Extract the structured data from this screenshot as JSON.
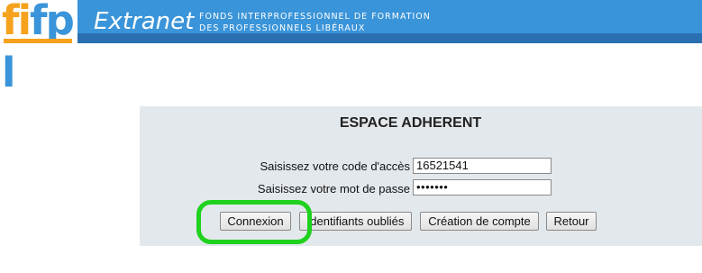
{
  "header": {
    "logo_letters": [
      "f",
      "i",
      "f",
      "p",
      "l"
    ],
    "logo_colors": [
      "#f6a21d",
      "#f6a21d",
      "#3a94d9",
      "#3a94d9",
      "#3a94d9"
    ],
    "title": "Extranet",
    "subtitle_line1": "FONDS INTERPROFESSIONNEL DE FORMATION",
    "subtitle_line2": "DES PROFESSIONNELS LIBÉRAUX"
  },
  "login": {
    "title": "ESPACE ADHERENT",
    "code_label": "Saisissez votre code d'accès",
    "code_value": "16521541",
    "password_label": "Saisissez votre mot de passe",
    "password_value": "•••••••"
  },
  "buttons": {
    "connexion": "Connexion",
    "identifiants": "Identifiants oubliés",
    "creation": "Création de compte",
    "retour": "Retour"
  },
  "colors": {
    "banner": "#3a94d9",
    "panel": "#e3e8ec",
    "highlight": "#1ed21e"
  }
}
